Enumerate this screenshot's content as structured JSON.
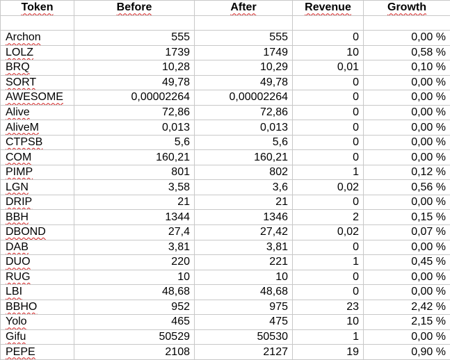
{
  "headers": [
    "Token",
    "Before",
    "After",
    "Revenue",
    "Growth"
  ],
  "rows": [
    [
      "Archon",
      "555",
      "555",
      "0",
      "0,00 %"
    ],
    [
      "LOLZ",
      "1739",
      "1749",
      "10",
      "0,58 %"
    ],
    [
      "BRQ",
      "10,28",
      "10,29",
      "0,01",
      "0,10 %"
    ],
    [
      "SORT",
      "49,78",
      "49,78",
      "0",
      "0,00 %"
    ],
    [
      "AWESOME",
      "0,00002264",
      "0,00002264",
      "0",
      "0,00 %"
    ],
    [
      "Alive",
      "72,86",
      "72,86",
      "0",
      "0,00 %"
    ],
    [
      "AliveM",
      "0,013",
      "0,013",
      "0",
      "0,00 %"
    ],
    [
      "CTPSB",
      "5,6",
      "5,6",
      "0",
      "0,00 %"
    ],
    [
      "COM",
      "160,21",
      "160,21",
      "0",
      "0,00 %"
    ],
    [
      "PIMP",
      "801",
      "802",
      "1",
      "0,12 %"
    ],
    [
      "LGN",
      "3,58",
      "3,6",
      "0,02",
      "0,56 %"
    ],
    [
      "DRIP",
      "21",
      "21",
      "0",
      "0,00 %"
    ],
    [
      "BBH",
      "1344",
      "1346",
      "2",
      "0,15 %"
    ],
    [
      "DBOND",
      "27,4",
      "27,42",
      "0,02",
      "0,07 %"
    ],
    [
      "DAB",
      "3,81",
      "3,81",
      "0",
      "0,00 %"
    ],
    [
      "DUO",
      "220",
      "221",
      "1",
      "0,45 %"
    ],
    [
      "RUG",
      "10",
      "10",
      "0",
      "0,00 %"
    ],
    [
      "LBI",
      "48,68",
      "48,68",
      "0",
      "0,00 %"
    ],
    [
      "BBHO",
      "952",
      "975",
      "23",
      "2,42 %"
    ],
    [
      "Yolo",
      "465",
      "475",
      "10",
      "2,15 %"
    ],
    [
      "Gifu",
      "50529",
      "50530",
      "1",
      "0,00 %"
    ],
    [
      "PEPE",
      "2108",
      "2127",
      "19",
      "0,90 %"
    ]
  ]
}
